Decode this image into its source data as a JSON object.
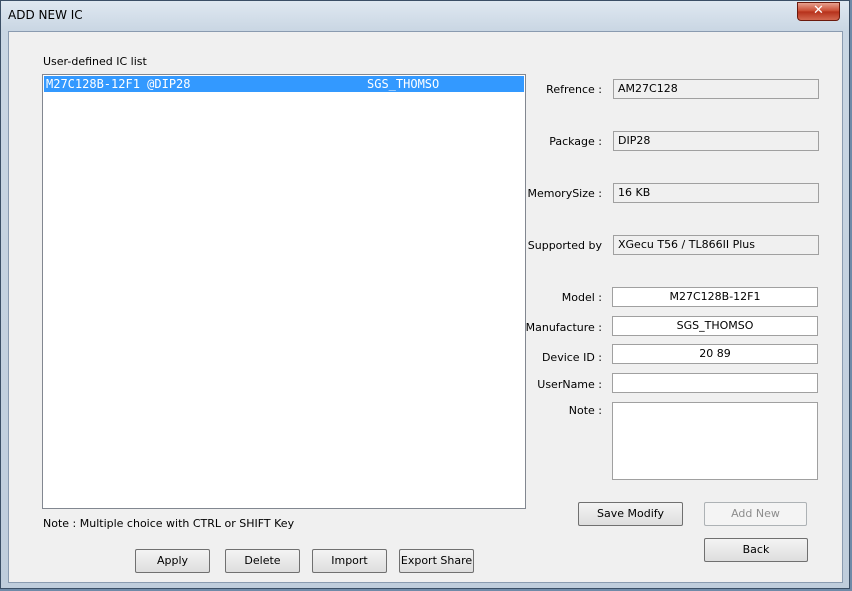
{
  "window": {
    "title": "ADD NEW IC",
    "close_glyph": "✕"
  },
  "list": {
    "label": "User-defined IC list",
    "rows": [
      {
        "part": "M27C128B-12F1 @DIP28",
        "maker": "SGS_THOMSO"
      }
    ],
    "note": "Note : Multiple choice with CTRL or SHIFT Key"
  },
  "info": {
    "reference": {
      "label": "Refrence :",
      "value": "AM27C128"
    },
    "package": {
      "label": "Package :",
      "value": "DIP28"
    },
    "memory_size": {
      "label": "MemorySize :",
      "value": "16 KB"
    },
    "supported_by": {
      "label": "Supported by",
      "value": "XGecu T56 / TL866II Plus"
    }
  },
  "edit": {
    "model": {
      "label": "Model :",
      "value": "M27C128B-12F1"
    },
    "manufacture": {
      "label": "Manufacture :",
      "value": "SGS_THOMSO"
    },
    "device_id": {
      "label": "Device ID :",
      "value": "20 89"
    },
    "username": {
      "label": "UserName :",
      "value": ""
    },
    "note": {
      "label": "Note :",
      "value": ""
    }
  },
  "buttons": {
    "save_modify": "Save Modify",
    "add_new": "Add New",
    "back": "Back",
    "apply": "Apply",
    "delete": "Delete",
    "import": "Import",
    "export_share": "Export Share"
  }
}
